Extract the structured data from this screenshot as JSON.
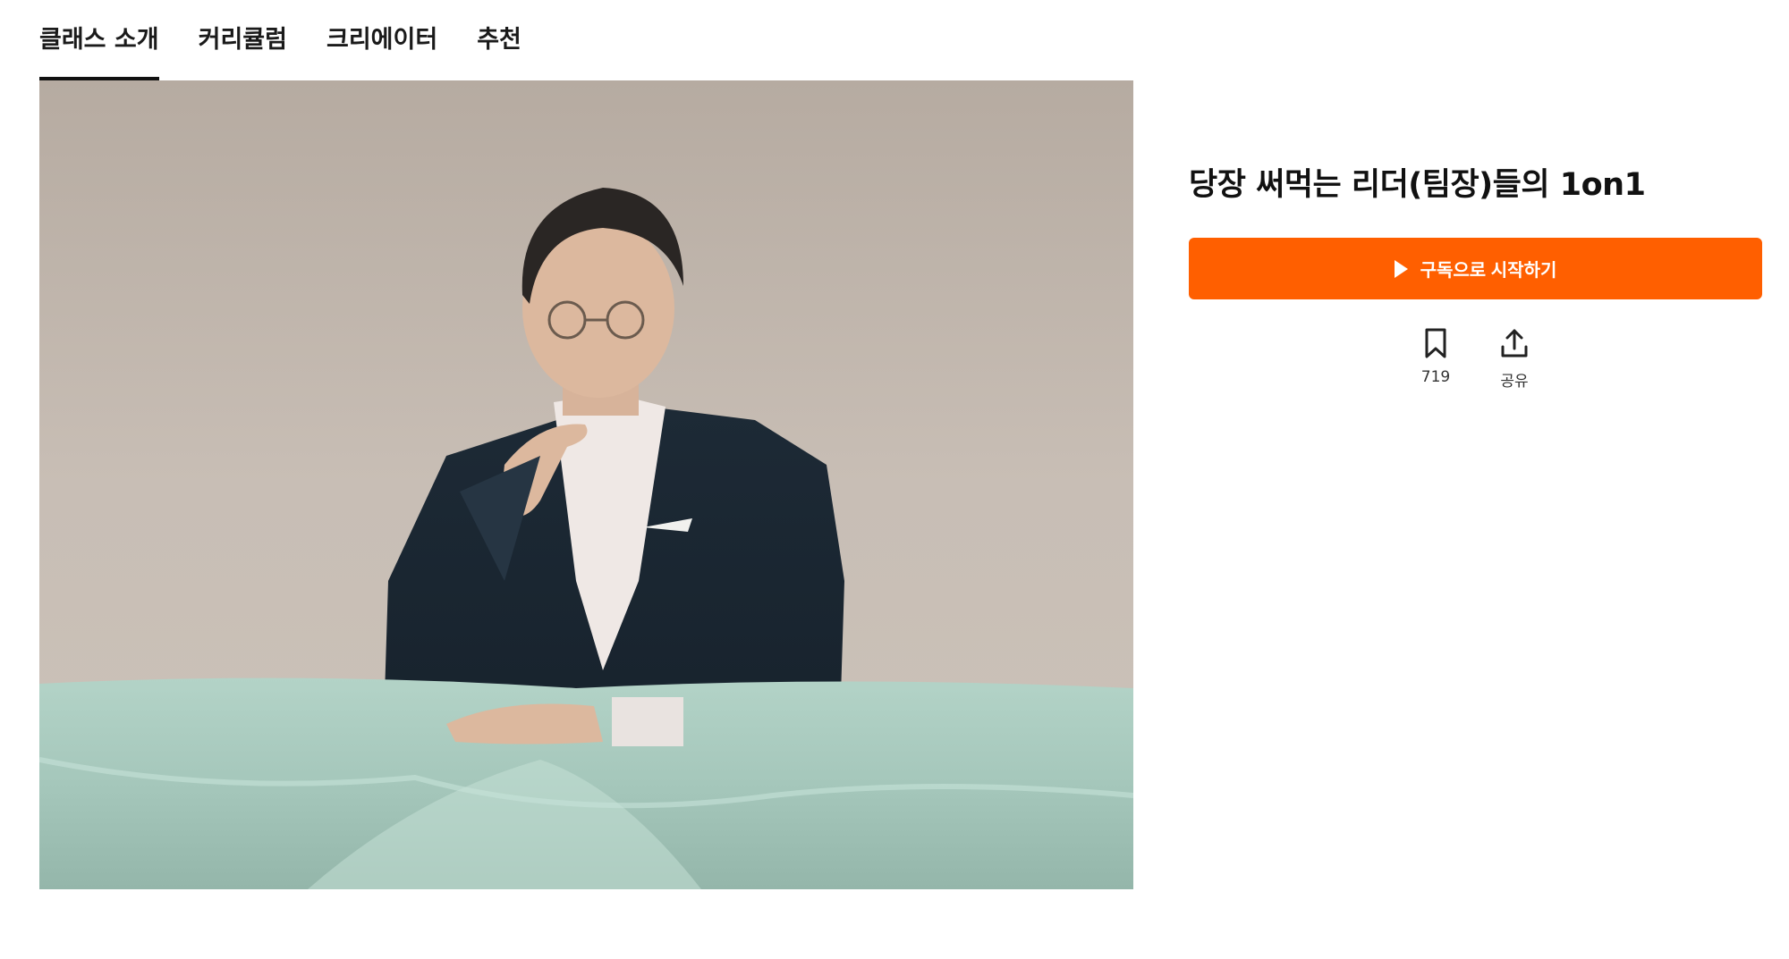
{
  "tabs": [
    {
      "label": "클래스 소개",
      "active": true
    },
    {
      "label": "커리큘럼",
      "active": false
    },
    {
      "label": "크리에이터",
      "active": false
    },
    {
      "label": "추천",
      "active": false
    }
  ],
  "course": {
    "title": "당장 써먹는 리더(팀장)들의 1on1",
    "cta_label": "구독으로 시작하기"
  },
  "actions": {
    "bookmark_count": "719",
    "share_label": "공유"
  },
  "colors": {
    "accent": "#ff5f00",
    "text": "#111111",
    "background": "#ffffff"
  },
  "icons": [
    "play-icon",
    "bookmark-icon",
    "share-icon"
  ]
}
